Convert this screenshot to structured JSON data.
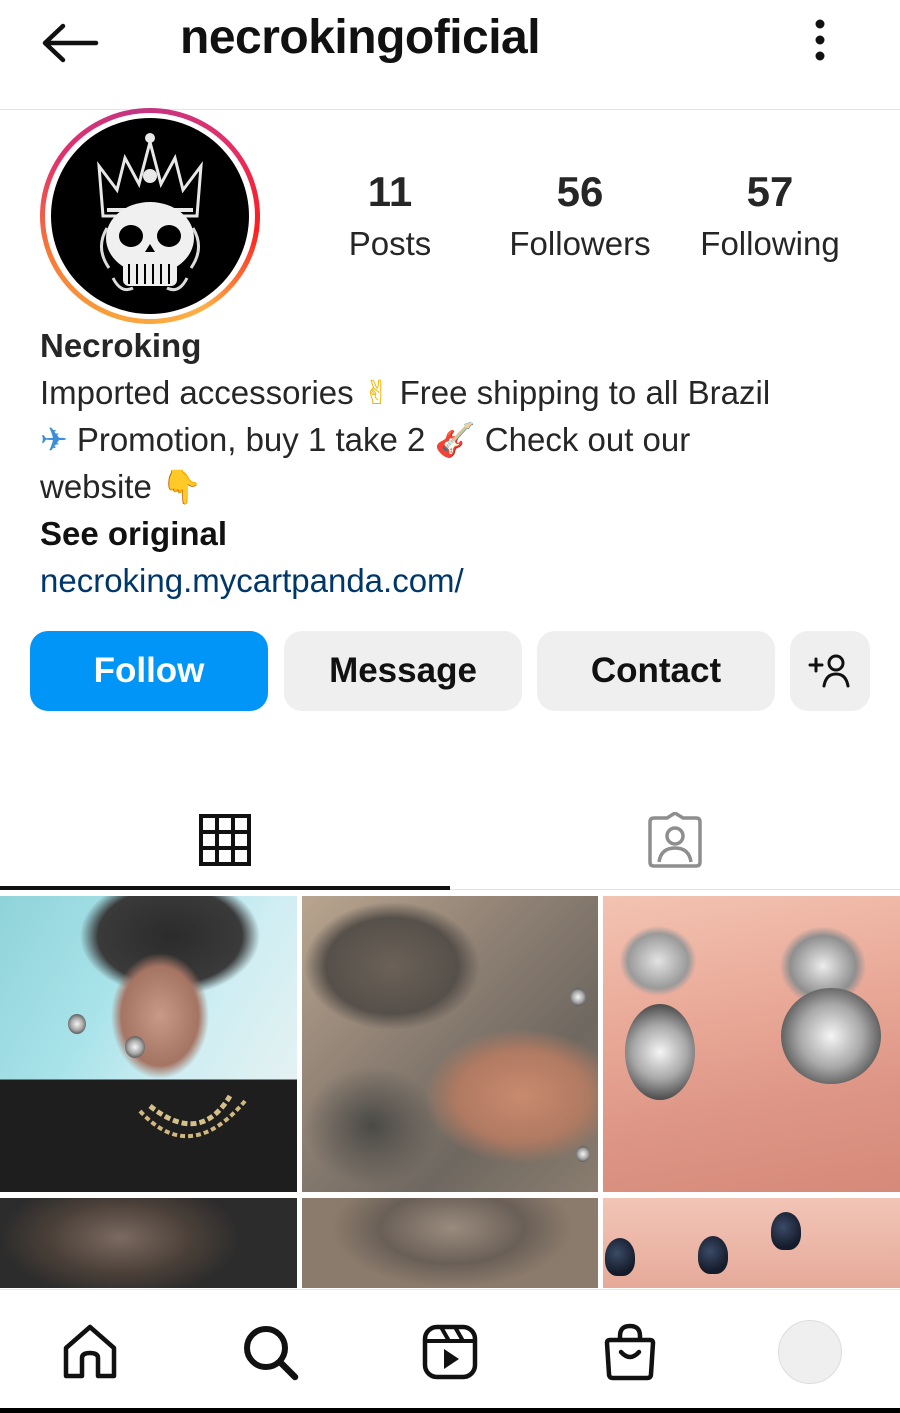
{
  "header": {
    "username": "necrokingoficial",
    "back_icon": "arrow-left-icon",
    "more_icon": "vertical-dots-icon"
  },
  "profile": {
    "avatar_icon": "skull-crown-logo",
    "stats": [
      {
        "value": "11",
        "label": "Posts"
      },
      {
        "value": "56",
        "label": "Followers"
      },
      {
        "value": "57",
        "label": "Following"
      }
    ],
    "display_name": "Necroking",
    "bio": {
      "part1": "Imported accessories ",
      "emoji1": "✌",
      "part2": " Free shipping to all Brazil",
      "emoji2": "✈",
      "part3": " Promotion, buy 1 take 2 ",
      "emoji3": "🎸",
      "part4": " Check out our",
      "part5": "website ",
      "emoji4": "👇"
    },
    "see_original": "See original",
    "link": "necroking.mycartpanda.com/"
  },
  "actions": {
    "follow": "Follow",
    "message": "Message",
    "contact": "Contact",
    "suggest_icon": "add-person-icon"
  },
  "tabs": [
    {
      "icon": "grid-icon",
      "active": true
    },
    {
      "icon": "tagged-person-icon",
      "active": false
    }
  ],
  "posts": [
    {
      "subject": "man-with-rings"
    },
    {
      "subject": "tattooed-hand",
      "multi": true
    },
    {
      "subject": "skull-rings-on-fingers"
    },
    {
      "subject": "tattooed-arm"
    },
    {
      "subject": "tattoo-closeup"
    },
    {
      "subject": "painted-nails"
    }
  ],
  "bottom_nav": [
    {
      "icon": "home-icon"
    },
    {
      "icon": "search-icon"
    },
    {
      "icon": "reels-icon"
    },
    {
      "icon": "shop-icon"
    },
    {
      "icon": "profile-avatar"
    }
  ],
  "colors": {
    "follow_button": "#0095f6",
    "secondary_button": "#efefef",
    "link": "#00376b",
    "text": "#262626"
  }
}
